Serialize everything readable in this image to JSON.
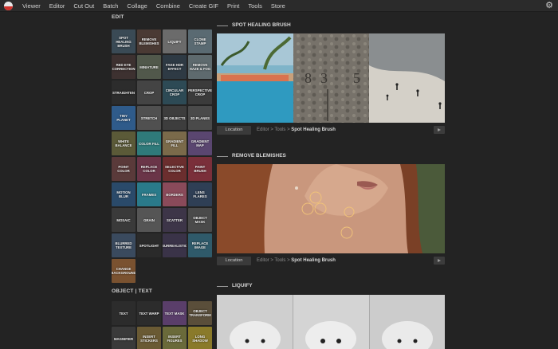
{
  "menu": {
    "items": [
      "Viewer",
      "Editor",
      "Cut Out",
      "Batch",
      "Collage",
      "Combine",
      "Create GIF",
      "Print",
      "Tools",
      "Store"
    ]
  },
  "sidebar": {
    "edit_title": "EDIT",
    "edit_tools": [
      {
        "label": "SPOT HEALING BRUSH",
        "color": "#3a4a55"
      },
      {
        "label": "REMOVE BLEMISHES",
        "color": "#4a3a34"
      },
      {
        "label": "LIQUIFY",
        "color": "#6b6b6b"
      },
      {
        "label": "CLONE STAMP",
        "color": "#5a6a72"
      },
      {
        "label": "RED EYE CORRECTION",
        "color": "#3d3130"
      },
      {
        "label": "MINIATURE",
        "color": "#51584b"
      },
      {
        "label": "FAKE HDR EFFECT",
        "color": "#2e3a44"
      },
      {
        "label": "REMOVE HAZE & FOG",
        "color": "#5e6a6e"
      },
      {
        "label": "STRAIGHTEN",
        "color": "#2c2c2c"
      },
      {
        "label": "CROP",
        "color": "#444444"
      },
      {
        "label": "CIRCULAR CROP",
        "color": "#2d4a55"
      },
      {
        "label": "PERSPECTIVE CROP",
        "color": "#3b3b3b"
      },
      {
        "label": "TINY PLANET",
        "color": "#2f5b8a"
      },
      {
        "label": "STRETCH",
        "color": "#505050"
      },
      {
        "label": "3D OBJECTS",
        "color": "#3d3d3d"
      },
      {
        "label": "3D PLANES",
        "color": "#4a4a4a"
      },
      {
        "label": "WHITE BALANCE",
        "color": "#5b5a38"
      },
      {
        "label": "COLOR FILL",
        "color": "#2f7a7a"
      },
      {
        "label": "GRADIENT FILL",
        "color": "#7a6a4a"
      },
      {
        "label": "GRADIENT MAP",
        "color": "#5a4670"
      },
      {
        "label": "POINT COLOR",
        "color": "#5a3a3a"
      },
      {
        "label": "REPLACE COLOR",
        "color": "#6a3548"
      },
      {
        "label": "SELECTIVE COLOR",
        "color": "#6b2e2e"
      },
      {
        "label": "PAINT BRUSH",
        "color": "#7a2f3a"
      },
      {
        "label": "MOTION BLUR",
        "color": "#2a4a6a"
      },
      {
        "label": "FRAMES",
        "color": "#2a7a8a"
      },
      {
        "label": "BORDERS",
        "color": "#8a4a5a"
      },
      {
        "label": "LENS FLARES",
        "color": "#2f3f55"
      },
      {
        "label": "MOSAIC",
        "color": "#3a3a3a"
      },
      {
        "label": "GRAIN",
        "color": "#555555"
      },
      {
        "label": "SCATTER",
        "color": "#3d3548"
      },
      {
        "label": "OBJECT MASK",
        "color": "#4a4a4a"
      },
      {
        "label": "BLURRED TEXTURE",
        "color": "#3a4a5e"
      },
      {
        "label": "SPOTLIGHT",
        "color": "#2a2a2a"
      },
      {
        "label": "SURREALISTIC",
        "color": "#3a3348"
      },
      {
        "label": "REPLACE IMAGE",
        "color": "#2f5a6a"
      },
      {
        "label": "CHANGE BACKGROUND",
        "color": "#7a5230"
      }
    ],
    "object_text_title": "OBJECT | TEXT",
    "object_tools": [
      {
        "label": "TEXT",
        "color": "#2c2c2c"
      },
      {
        "label": "TEXT WARP",
        "color": "#2c2c2c"
      },
      {
        "label": "TEXT MASK",
        "color": "#5a3e6a"
      },
      {
        "label": "OBJECT TRANSFORM",
        "color": "#5a4e3a"
      },
      {
        "label": "MAGNIFIER",
        "color": "#3a3a3a"
      },
      {
        "label": "INSERT STICKERS",
        "color": "#6a5a34"
      },
      {
        "label": "INSERT FIGURES",
        "color": "#6a6a3a"
      },
      {
        "label": "LONG SHADOW",
        "color": "#8a7a2a"
      }
    ]
  },
  "sections": [
    {
      "title": "SPOT HEALING BRUSH",
      "location_label": "Location",
      "breadcrumb_prefix": "Editor > Tools > ",
      "breadcrumb_current": "Spot Healing Brush"
    },
    {
      "title": "REMOVE BLEMISHES",
      "location_label": "Location",
      "breadcrumb_prefix": "Editor > Tools > ",
      "breadcrumb_current": "Spot Healing Brush"
    },
    {
      "title": "LIQUIFY"
    }
  ]
}
